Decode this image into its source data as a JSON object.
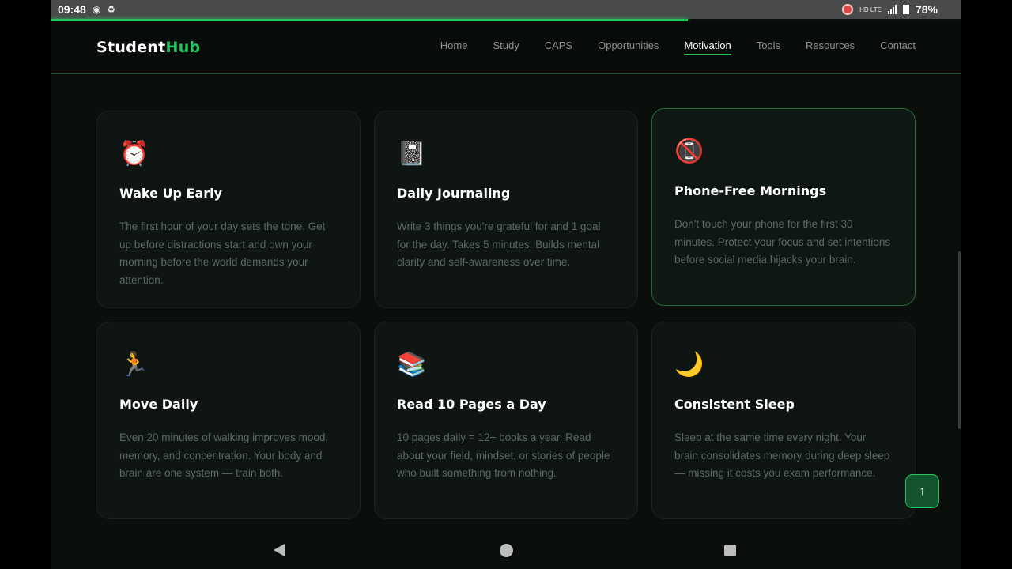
{
  "status": {
    "time": "09:48",
    "left_icons": [
      "record-icon",
      "sync-icon"
    ],
    "network_label": "HD LTE",
    "battery": "78%"
  },
  "scroll_progress": 0.7,
  "brand": {
    "part1": "Student",
    "part2": "Hub",
    "accent": "#22c55e"
  },
  "nav": {
    "links": [
      "Home",
      "Study",
      "CAPS",
      "Opportunities",
      "Motivation",
      "Tools",
      "Resources",
      "Contact"
    ],
    "active": "Motivation"
  },
  "cards": [
    {
      "icon": "⏰",
      "icon_name": "alarm-clock-icon",
      "title": "Wake Up Early",
      "text": "The first hour of your day sets the tone. Get up before distractions start and own your morning before the world demands your attention."
    },
    {
      "icon": "📓",
      "icon_name": "notebook-icon",
      "title": "Daily Journaling",
      "text": "Write 3 things you're grateful for and 1 goal for the day. Takes 5 minutes. Builds mental clarity and self-awareness over time."
    },
    {
      "icon": "📵",
      "icon_name": "no-phones-icon",
      "title": "Phone-Free Mornings",
      "text": "Don't touch your phone for the first 30 minutes. Protect your focus and set intentions before social media hijacks your brain."
    },
    {
      "icon": "🏃",
      "icon_name": "runner-icon",
      "title": "Move Daily",
      "text": "Even 20 minutes of walking improves mood, memory, and concentration. Your body and brain are one system — train both."
    },
    {
      "icon": "📚",
      "icon_name": "books-icon",
      "title": "Read 10 Pages a Day",
      "text": "10 pages daily = 12+ books a year. Read about your field, mindset, or stories of people who built something from nothing."
    },
    {
      "icon": "🌙",
      "icon_name": "crescent-moon-icon",
      "title": "Consistent Sleep",
      "text": "Sleep at the same time every night. Your brain consolidates memory during deep sleep — missing it costs you exam performance."
    }
  ],
  "back_to_top": {
    "icon": "↑",
    "icon_name": "arrow-up-icon"
  }
}
